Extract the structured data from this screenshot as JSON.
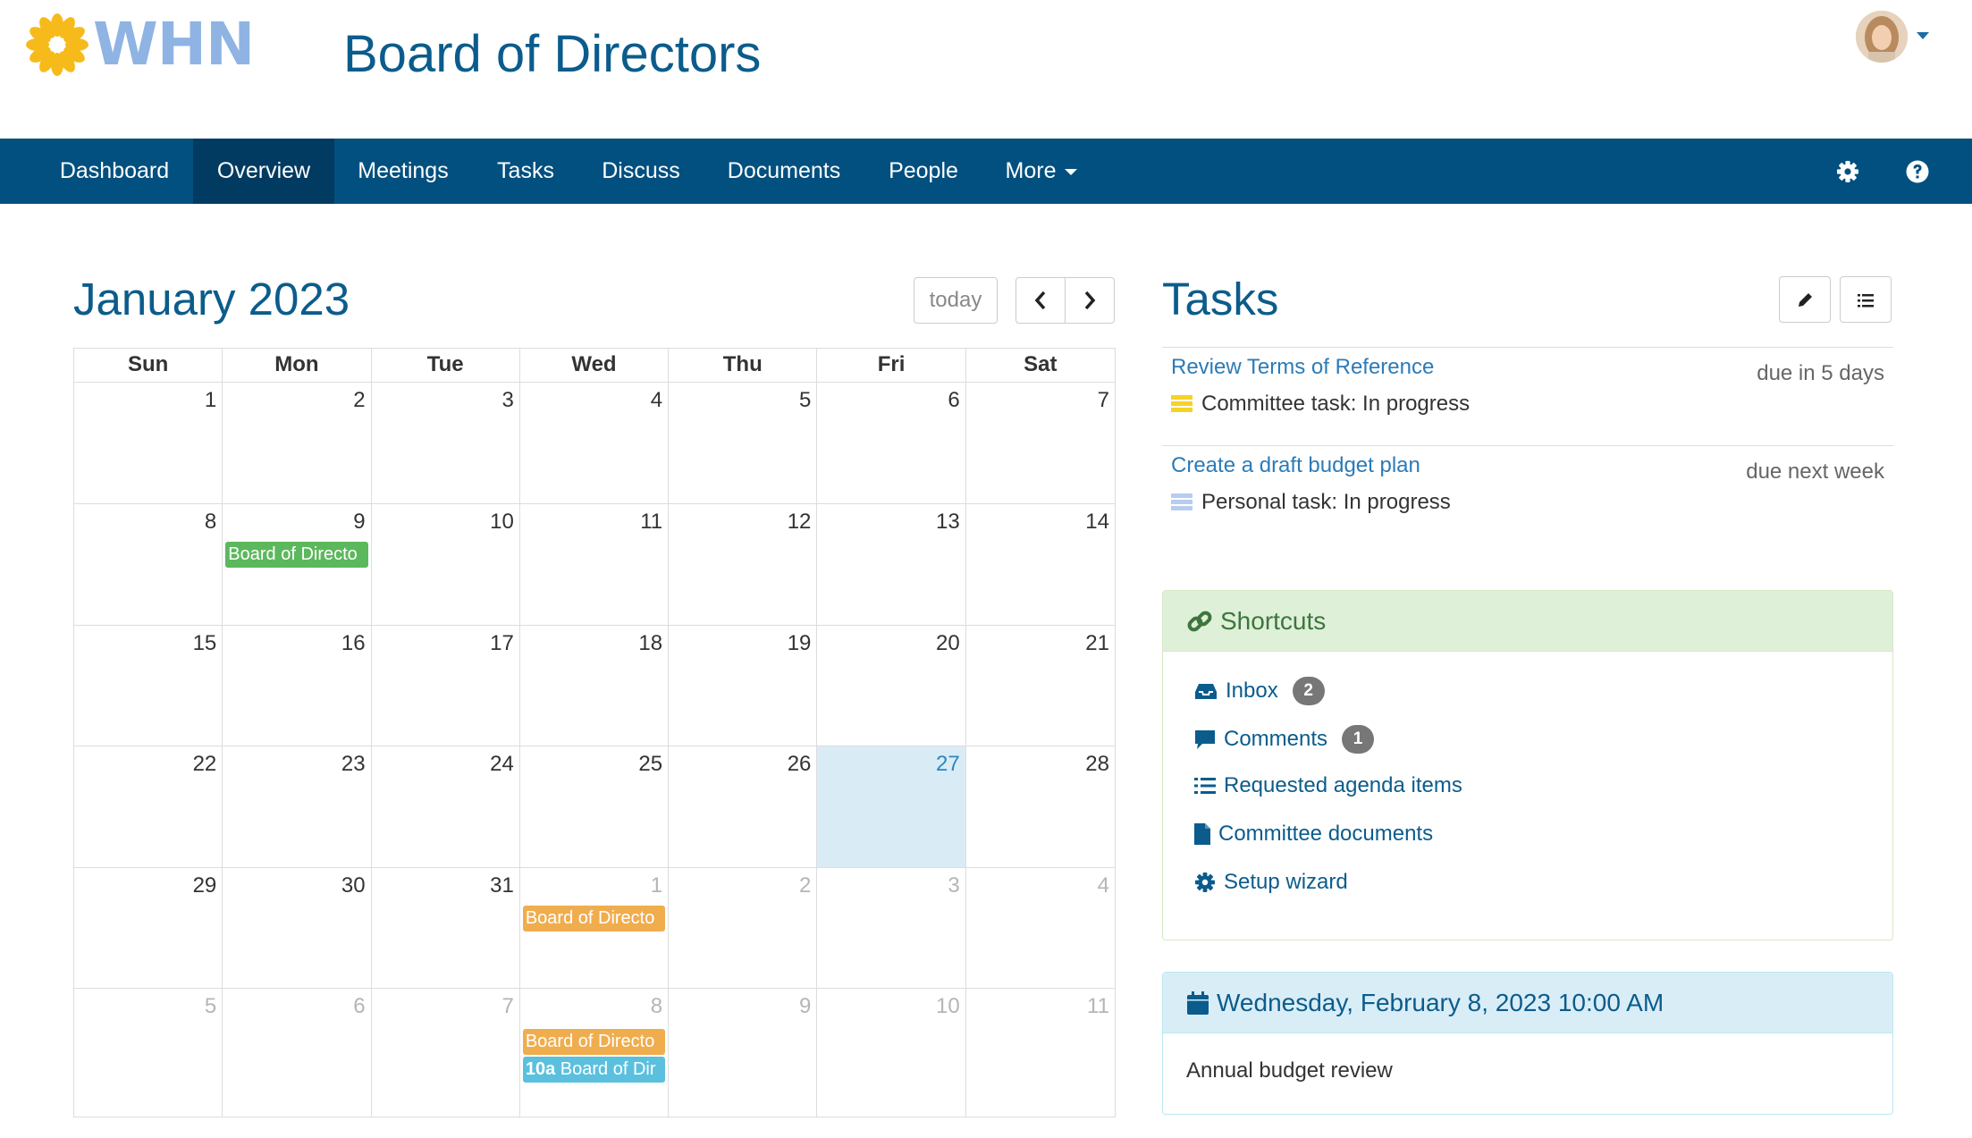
{
  "header": {
    "logo_text": "WHN",
    "title": "Board of Directors"
  },
  "nav": {
    "items": [
      "Dashboard",
      "Overview",
      "Meetings",
      "Tasks",
      "Discuss",
      "Documents",
      "People",
      "More"
    ],
    "active": "Overview",
    "settings_icon": "gear-icon",
    "help_icon": "question-circle-icon"
  },
  "calendar": {
    "title": "January 2023",
    "today_label": "today",
    "weekdays": [
      "Sun",
      "Mon",
      "Tue",
      "Wed",
      "Thu",
      "Fri",
      "Sat"
    ],
    "weeks": [
      [
        "1",
        "2",
        "3",
        "4",
        "5",
        "6",
        "7"
      ],
      [
        "8",
        "9",
        "10",
        "11",
        "12",
        "13",
        "14"
      ],
      [
        "15",
        "16",
        "17",
        "18",
        "19",
        "20",
        "21"
      ],
      [
        "22",
        "23",
        "24",
        "25",
        "26",
        "27",
        "28"
      ],
      [
        "29",
        "30",
        "31",
        "1",
        "2",
        "3",
        "4"
      ],
      [
        "5",
        "6",
        "7",
        "8",
        "9",
        "10",
        "11"
      ]
    ],
    "events": [
      {
        "label": "Board of Directo",
        "time": "",
        "color": "#5cb85c"
      },
      {
        "label": "Board of Directo",
        "time": "",
        "color": "#f0ad4e"
      },
      {
        "label": "Board of Directo",
        "time": "",
        "color": "#f0ad4e"
      },
      {
        "label": "Board of Dir",
        "time": "10a",
        "color": "#5bc0de"
      }
    ]
  },
  "tasks": {
    "title": "Tasks",
    "items": [
      {
        "name": "Review Terms of Reference",
        "due": "due in 5 days",
        "status": "Committee task: In progress",
        "swatch": "#f5d327"
      },
      {
        "name": "Create a draft budget plan",
        "due": "due next week",
        "status": "Personal task: In progress",
        "swatch": "#b7cdf0"
      }
    ]
  },
  "shortcuts": {
    "title": "Shortcuts",
    "items": [
      {
        "label": "Inbox",
        "badge": "2"
      },
      {
        "label": "Comments",
        "badge": "1"
      },
      {
        "label": "Requested agenda items",
        "badge": ""
      },
      {
        "label": "Committee documents",
        "badge": ""
      },
      {
        "label": "Setup wizard",
        "badge": ""
      }
    ]
  },
  "meeting": {
    "datetime": "Wednesday, February 8, 2023 10:00 AM",
    "description": "Annual budget review"
  },
  "colors": {
    "brand": "#0b5c8c",
    "navbar": "#02507f",
    "navbar_active": "#023b61",
    "shortcuts_head": "#dff0d8",
    "meeting_head": "#d9edf7"
  }
}
